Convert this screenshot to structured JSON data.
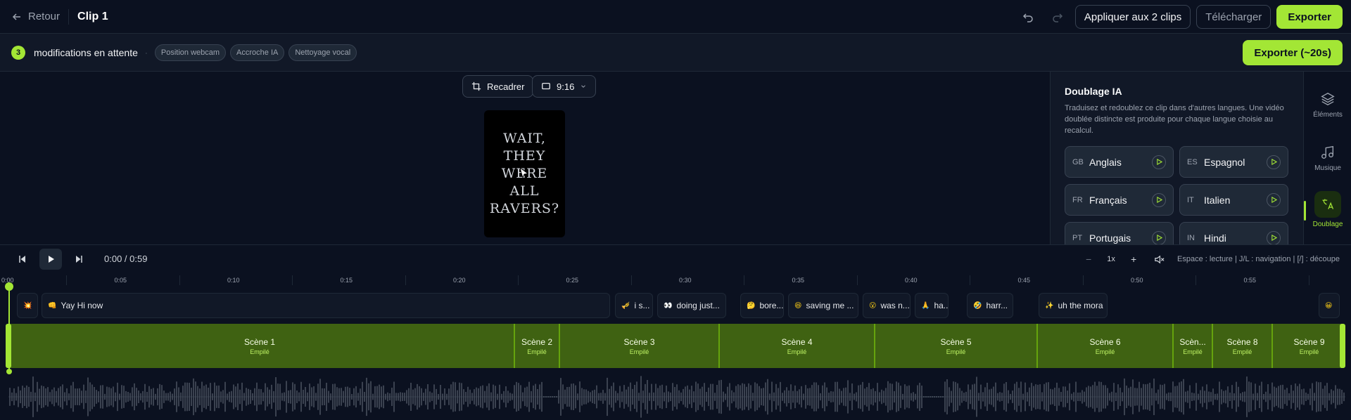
{
  "topbar": {
    "back_label": "Retour",
    "clip_title": "Clip 1",
    "apply_label": "Appliquer aux 2 clips",
    "download_label": "Télécharger",
    "export_label": "Exporter"
  },
  "pending": {
    "count": "3",
    "text": "modifications en attente",
    "separator": "·",
    "chips": [
      "Position webcam",
      "Accroche IA",
      "Nettoyage vocal"
    ],
    "export_label": "Exporter (~20s)"
  },
  "stage": {
    "recadrer_label": "Recadrer",
    "ratio_label": "9:16",
    "video_text": "WAIT, THEY WERE ALL RAVERS?"
  },
  "panel": {
    "title": "Doublage IA",
    "description": "Traduisez et redoublez ce clip dans d'autres langues. Une vidéo doublée distincte est produite pour chaque langue choisie au recalcul.",
    "languages": [
      {
        "code": "GB",
        "name": "Anglais"
      },
      {
        "code": "ES",
        "name": "Espagnol"
      },
      {
        "code": "FR",
        "name": "Français"
      },
      {
        "code": "IT",
        "name": "Italien"
      },
      {
        "code": "PT",
        "name": "Portugais"
      },
      {
        "code": "IN",
        "name": "Hindi"
      }
    ]
  },
  "rail": {
    "elements_label": "Éléments",
    "music_label": "Musique",
    "dub_label": "Doublage"
  },
  "transport": {
    "timecode": "0:00 / 0:59",
    "minus": "−",
    "speed": "1x",
    "plus": "+",
    "shortcuts": "Espace : lecture | J/L : navigation | [/] : découpe"
  },
  "ruler": {
    "ticks": [
      "0:00",
      "0:05",
      "0:10",
      "0:15",
      "0:20",
      "0:25",
      "0:30",
      "0:35",
      "0:40",
      "0:45",
      "0:50",
      "0:55"
    ]
  },
  "captions": [
    {
      "emoji": "💥",
      "text": ""
    },
    {
      "emoji": "👊",
      "text": "Yay Hi now"
    },
    {
      "emoji": "🎺",
      "text": "i s..."
    },
    {
      "emoji": "👀",
      "text": "doing just..."
    },
    {
      "emoji": "🤔",
      "text": "bore..."
    },
    {
      "emoji": "😆",
      "text": "saving me ..."
    },
    {
      "emoji": "😮",
      "text": "was n..."
    },
    {
      "emoji": "🙏",
      "text": "ha..."
    },
    {
      "emoji": "🤣",
      "text": "harr..."
    },
    {
      "emoji": "✨",
      "text": "uh the mora"
    },
    {
      "emoji": "😀",
      "text": ""
    }
  ],
  "scenes": [
    {
      "name": "Scène 1",
      "sub": "Empilé"
    },
    {
      "name": "Scène 2",
      "sub": "Empilé"
    },
    {
      "name": "Scène 3",
      "sub": "Empilé"
    },
    {
      "name": "Scène 4",
      "sub": "Empilé"
    },
    {
      "name": "Scène 5",
      "sub": "Empilé"
    },
    {
      "name": "Scène 6",
      "sub": "Empilé"
    },
    {
      "name": "Scèn...",
      "sub": "Empilé"
    },
    {
      "name": "Scène 8",
      "sub": "Empilé"
    },
    {
      "name": "Scène 9",
      "sub": "Empilé"
    }
  ],
  "colors": {
    "accent": "#a3e635",
    "scene_fill": "#3f6212",
    "background": "#0b1120"
  }
}
